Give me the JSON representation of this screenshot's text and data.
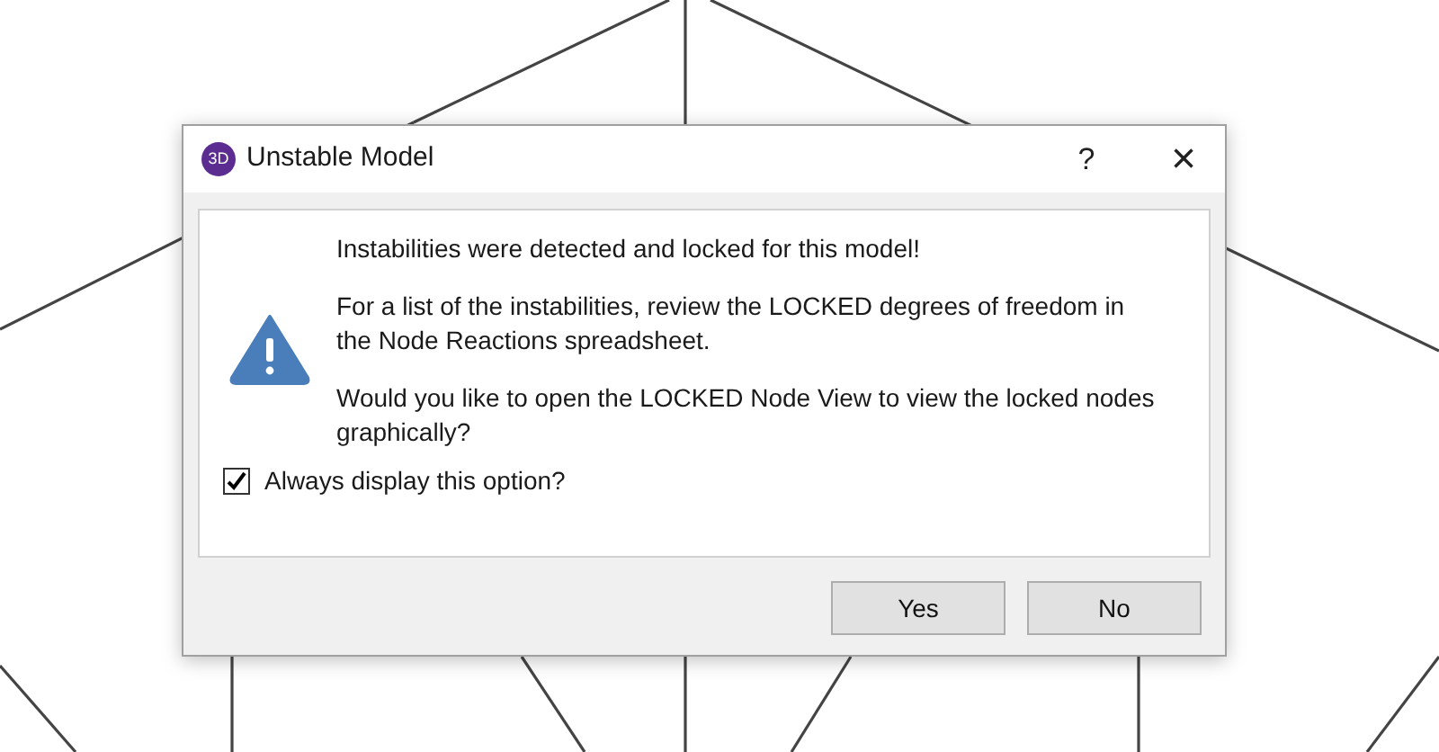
{
  "window": {
    "app_badge": "3D",
    "title": "Unstable Model",
    "help": "?",
    "close": "×"
  },
  "message": {
    "paragraphs": [
      "Instabilities were detected and locked for this model!",
      "For a list of the instabilities, review the LOCKED degrees of freedom in the Node Reactions spreadsheet.",
      "Would you like to open the LOCKED Node View to view the locked nodes graphically?"
    ]
  },
  "checkbox": {
    "label": "Always display this option?",
    "checked": true
  },
  "buttons": [
    {
      "label": "Yes"
    },
    {
      "label": "No"
    }
  ]
}
